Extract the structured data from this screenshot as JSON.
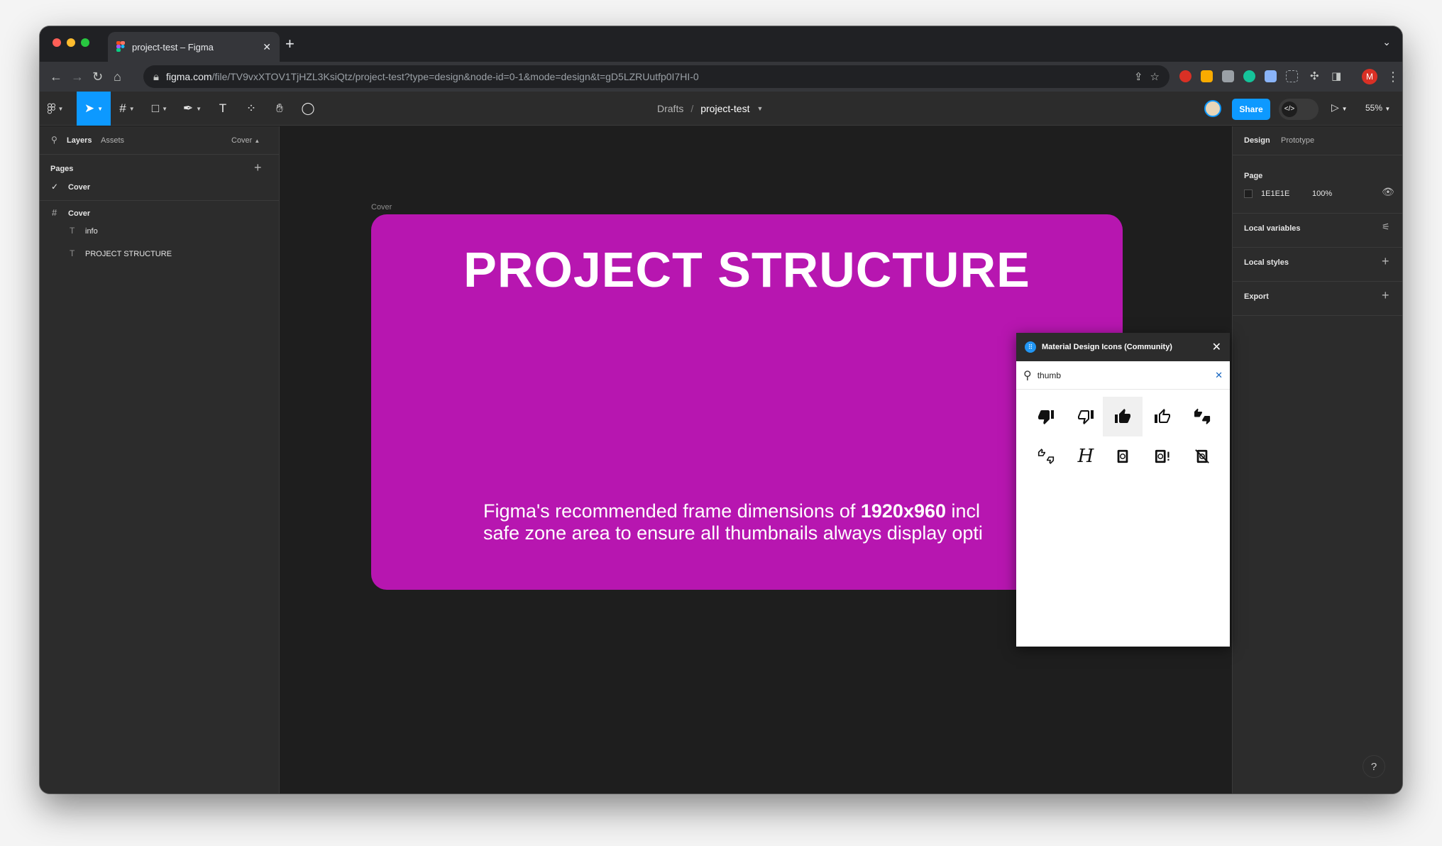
{
  "browser": {
    "tab_title": "project-test – Figma",
    "new_tab_symbol": "+",
    "url_host": "figma.com",
    "url_path": "/file/TV9vxXTOV1TjHZL3KsiQtz/project-test?type=design&node-id=0-1&mode=design&t=gD5LZRUutfp0I7HI-0",
    "profile_initial": "M",
    "traffic_colors": [
      "#ff5f57",
      "#febc2e",
      "#28c840"
    ]
  },
  "figma_toolbar": {
    "breadcrumb_drafts": "Drafts",
    "breadcrumb_sep": "/",
    "file_name": "project-test",
    "share_label": "Share",
    "zoom_label": "55%",
    "accent_color": "#0d99ff"
  },
  "left_panel": {
    "tab_layers": "Layers",
    "tab_assets": "Assets",
    "page_dropdown": "Cover",
    "pages_heading": "Pages",
    "pages": [
      {
        "name": "Cover",
        "selected": true
      }
    ],
    "layers": {
      "frame": "Cover",
      "children": [
        "info",
        "PROJECT STRUCTURE"
      ]
    }
  },
  "canvas": {
    "frame_label": "Cover",
    "frame_fill": "#b716b0",
    "title": "PROJECT STRUCTURE",
    "info_line1_a": "Figma's recommended frame dimensions of ",
    "info_line1_b": "1920x960",
    "info_line1_c": " incl",
    "info_line2": "safe zone area to ensure all thumbnails always display opti"
  },
  "plugin": {
    "title": "Material Design Icons (Community)",
    "search_value": "thumb",
    "icons": [
      "thumb-down-icon",
      "thumb-down-outline-icon",
      "thumb-up-icon",
      "thumb-up-outline-icon",
      "thumbs-up-down-icon",
      "thumbs-up-down-outline-icon",
      "hubspot-h-icon",
      "notebook-icon",
      "notebook-alert-icon",
      "notebook-off-icon"
    ]
  },
  "right_panel": {
    "tab_design": "Design",
    "tab_prototype": "Prototype",
    "page_heading": "Page",
    "page_color": "1E1E1E",
    "page_opacity": "100%",
    "local_variables": "Local variables",
    "local_styles": "Local styles",
    "export": "Export"
  },
  "help": "?"
}
